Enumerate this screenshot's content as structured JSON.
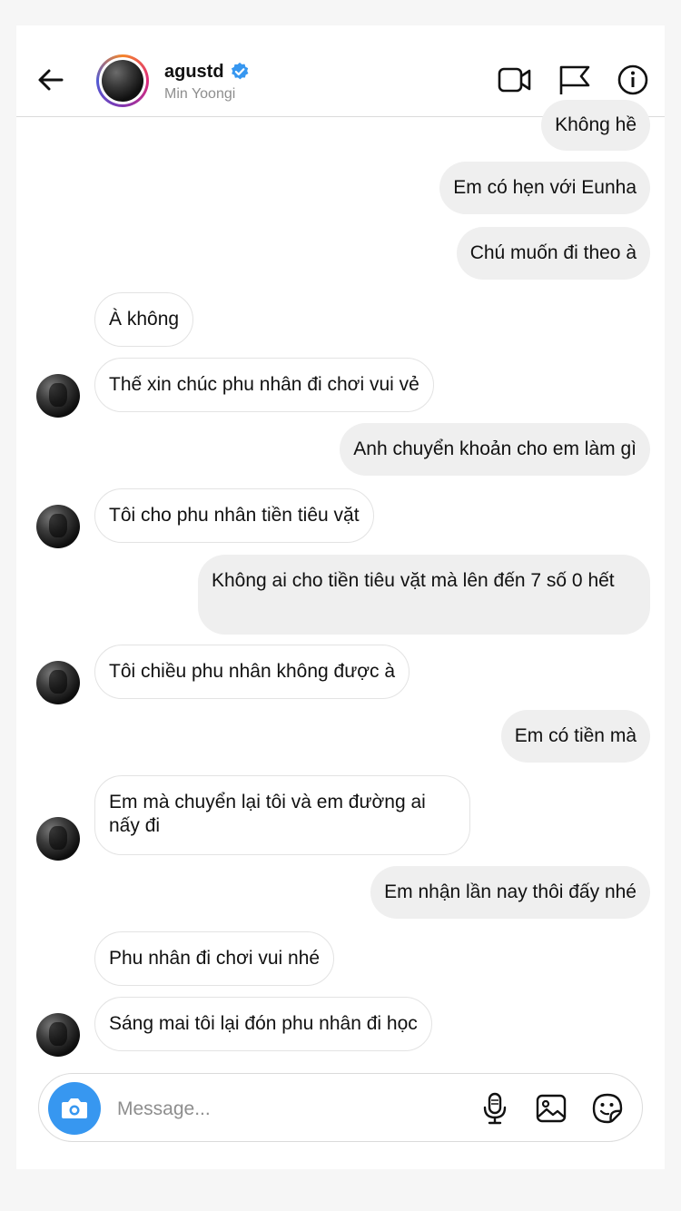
{
  "header": {
    "username": "agustd",
    "display_name": "Min Yoongi",
    "verified": true
  },
  "messages": [
    {
      "from": "me",
      "text": "Không hề"
    },
    {
      "from": "me",
      "text": "Em có hẹn với Eunha"
    },
    {
      "from": "me",
      "text": "Chú muốn đi theo à"
    },
    {
      "from": "them",
      "text": "À không"
    },
    {
      "from": "them",
      "text": "Thế xin chúc phu nhân đi chơi vui vẻ"
    },
    {
      "from": "me",
      "text": "Anh chuyển khoản cho em làm gì"
    },
    {
      "from": "them",
      "text": "Tôi cho phu nhân tiền tiêu vặt"
    },
    {
      "from": "me",
      "text": "Không ai cho tiền tiêu vặt mà lên đến 7 số 0 hết"
    },
    {
      "from": "them",
      "text": "Tôi chiều phu nhân không được à"
    },
    {
      "from": "me",
      "text": "Em có tiền mà"
    },
    {
      "from": "them",
      "text": "Em mà chuyển lại tôi và em đường ai nấy đi"
    },
    {
      "from": "me",
      "text": "Em nhận lần nay thôi đấy nhé"
    },
    {
      "from": "them",
      "text": "Phu nhân đi chơi vui nhé"
    },
    {
      "from": "them",
      "text": "Sáng mai tôi lại đón phu nhân đi học"
    }
  ],
  "composer": {
    "placeholder": "Message..."
  },
  "colors": {
    "accent": "#3797f0",
    "outgoing_bubble": "#efefef",
    "secondary_text": "#8e8e8e"
  },
  "icons": {
    "back": "arrow-left-icon",
    "video": "video-camera-icon",
    "report": "flag-icon",
    "info": "info-icon",
    "camera": "camera-icon",
    "mic": "microphone-icon",
    "gallery": "image-icon",
    "sticker": "sticker-icon"
  }
}
